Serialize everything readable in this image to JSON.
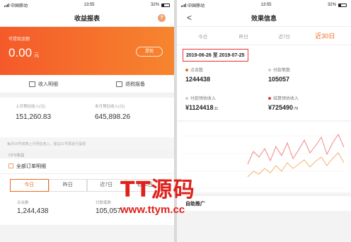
{
  "left": {
    "status": {
      "carrier": "中国移动",
      "time": "13:55",
      "battery": "32%"
    },
    "nav": {
      "title": "收益报表"
    },
    "balance": {
      "label": "可提现金额",
      "amount": "0.00",
      "unit": "元",
      "withdraw": "提现"
    },
    "actions": [
      {
        "label": "收入明细"
      },
      {
        "label": "退税报备"
      }
    ],
    "estimate": [
      {
        "label": "上月预估收入(元)",
        "value": "151,260.83"
      },
      {
        "label": "本月预估收入(元)",
        "value": "645,898.26"
      }
    ],
    "note": "每月20号结算上月预估收入，建议21号再进行提现",
    "cps_label": "CPS收益",
    "all_orders": "全部订单明细",
    "day_tabs": [
      "今日",
      "昨日",
      "近7日",
      "近30日"
    ],
    "bottom": [
      {
        "label": "点击数",
        "value": "1,244,438"
      },
      {
        "label": "付款笔数",
        "value": "105,057"
      }
    ]
  },
  "right": {
    "status": {
      "carrier": "中国移动",
      "time": "13:55",
      "battery": "32%"
    },
    "nav": {
      "title": "效果信息",
      "back": "<"
    },
    "tabs": [
      "今日",
      "昨日",
      "近7日",
      "近30日"
    ],
    "active_tab": 3,
    "date_range": "2019-06-26 至 2019-07-25",
    "metrics": [
      {
        "label": "点击数",
        "value": "1244438",
        "decimal": "",
        "color": "#f2691e"
      },
      {
        "label": "付款笔数",
        "value": "105057",
        "decimal": "",
        "color": "#cccccc"
      },
      {
        "label": "付款预估收入",
        "value": "¥1124418",
        "decimal": ".11",
        "color": "#cccccc"
      },
      {
        "label": "结算预估收入",
        "value": "¥725490",
        "decimal": ".79",
        "color": "#e33a3a"
      }
    ],
    "bottom_title": "自助推广"
  },
  "watermark": {
    "brand": "TT源码",
    "url": "www.ttym.cc"
  },
  "colors": {
    "orange": "#f2691e",
    "red": "#e0201b"
  }
}
